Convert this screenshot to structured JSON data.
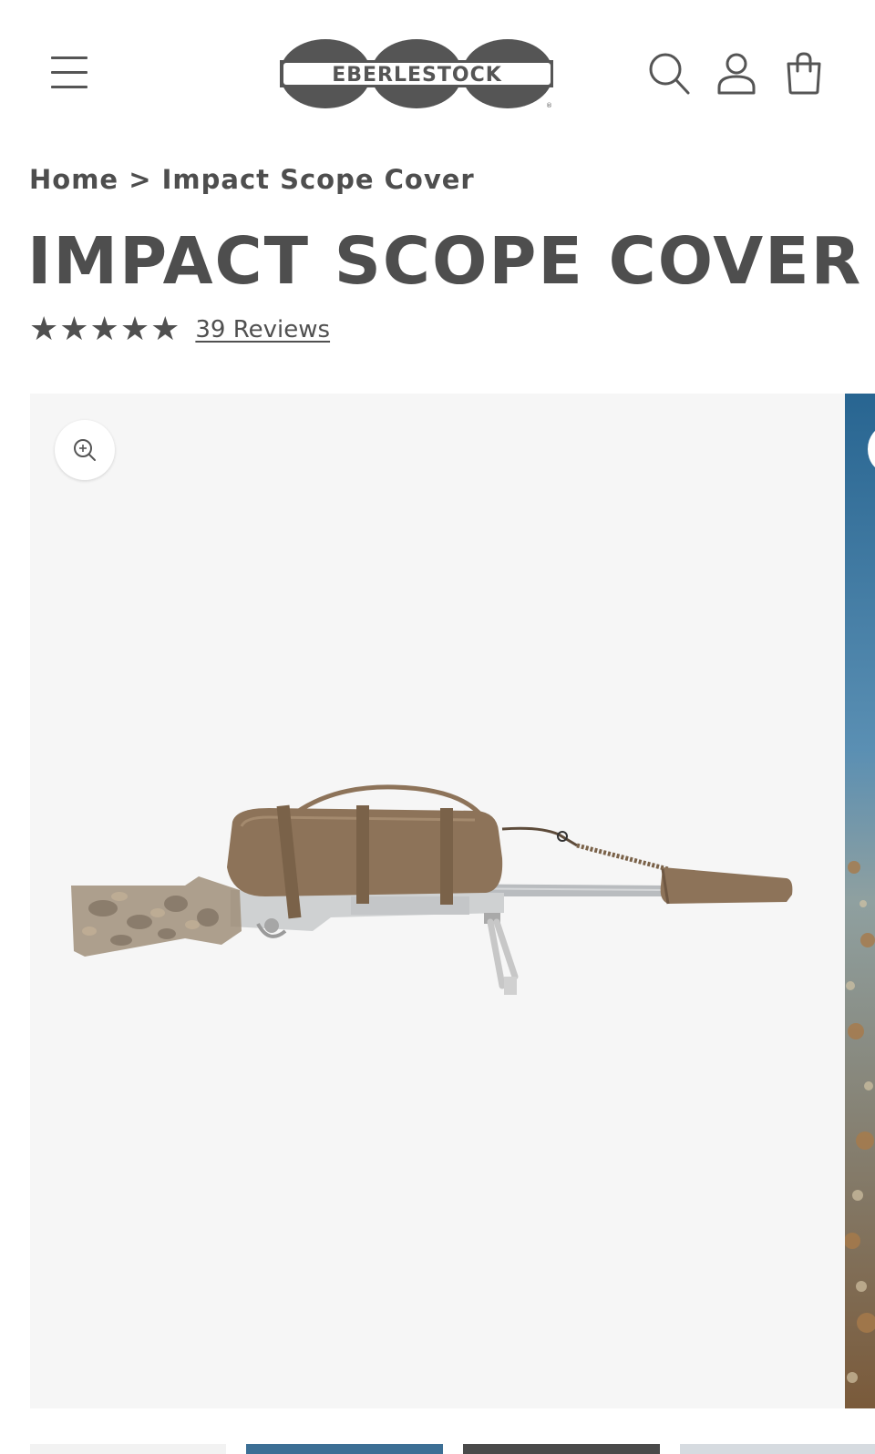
{
  "brand": {
    "logo_text": "EBERLESTOCK",
    "logo_color": "#555555"
  },
  "header": {
    "menu_icon": "hamburger-menu-icon",
    "search_icon": "search-icon",
    "account_icon": "account-icon",
    "cart_icon": "cart-icon"
  },
  "breadcrumb": {
    "home": "Home",
    "separator": ">",
    "current": "Impact Scope Cover"
  },
  "product": {
    "title": "IMPACT SCOPE COVER",
    "stars": "★★★★★",
    "rating": 5,
    "reviews_label": "39 Reviews"
  },
  "gallery": {
    "zoom_icon": "zoom-in-icon",
    "main_image": "rifle-with-scope-cover",
    "background": "#f6f6f6",
    "cover_color": "#8d7359"
  }
}
